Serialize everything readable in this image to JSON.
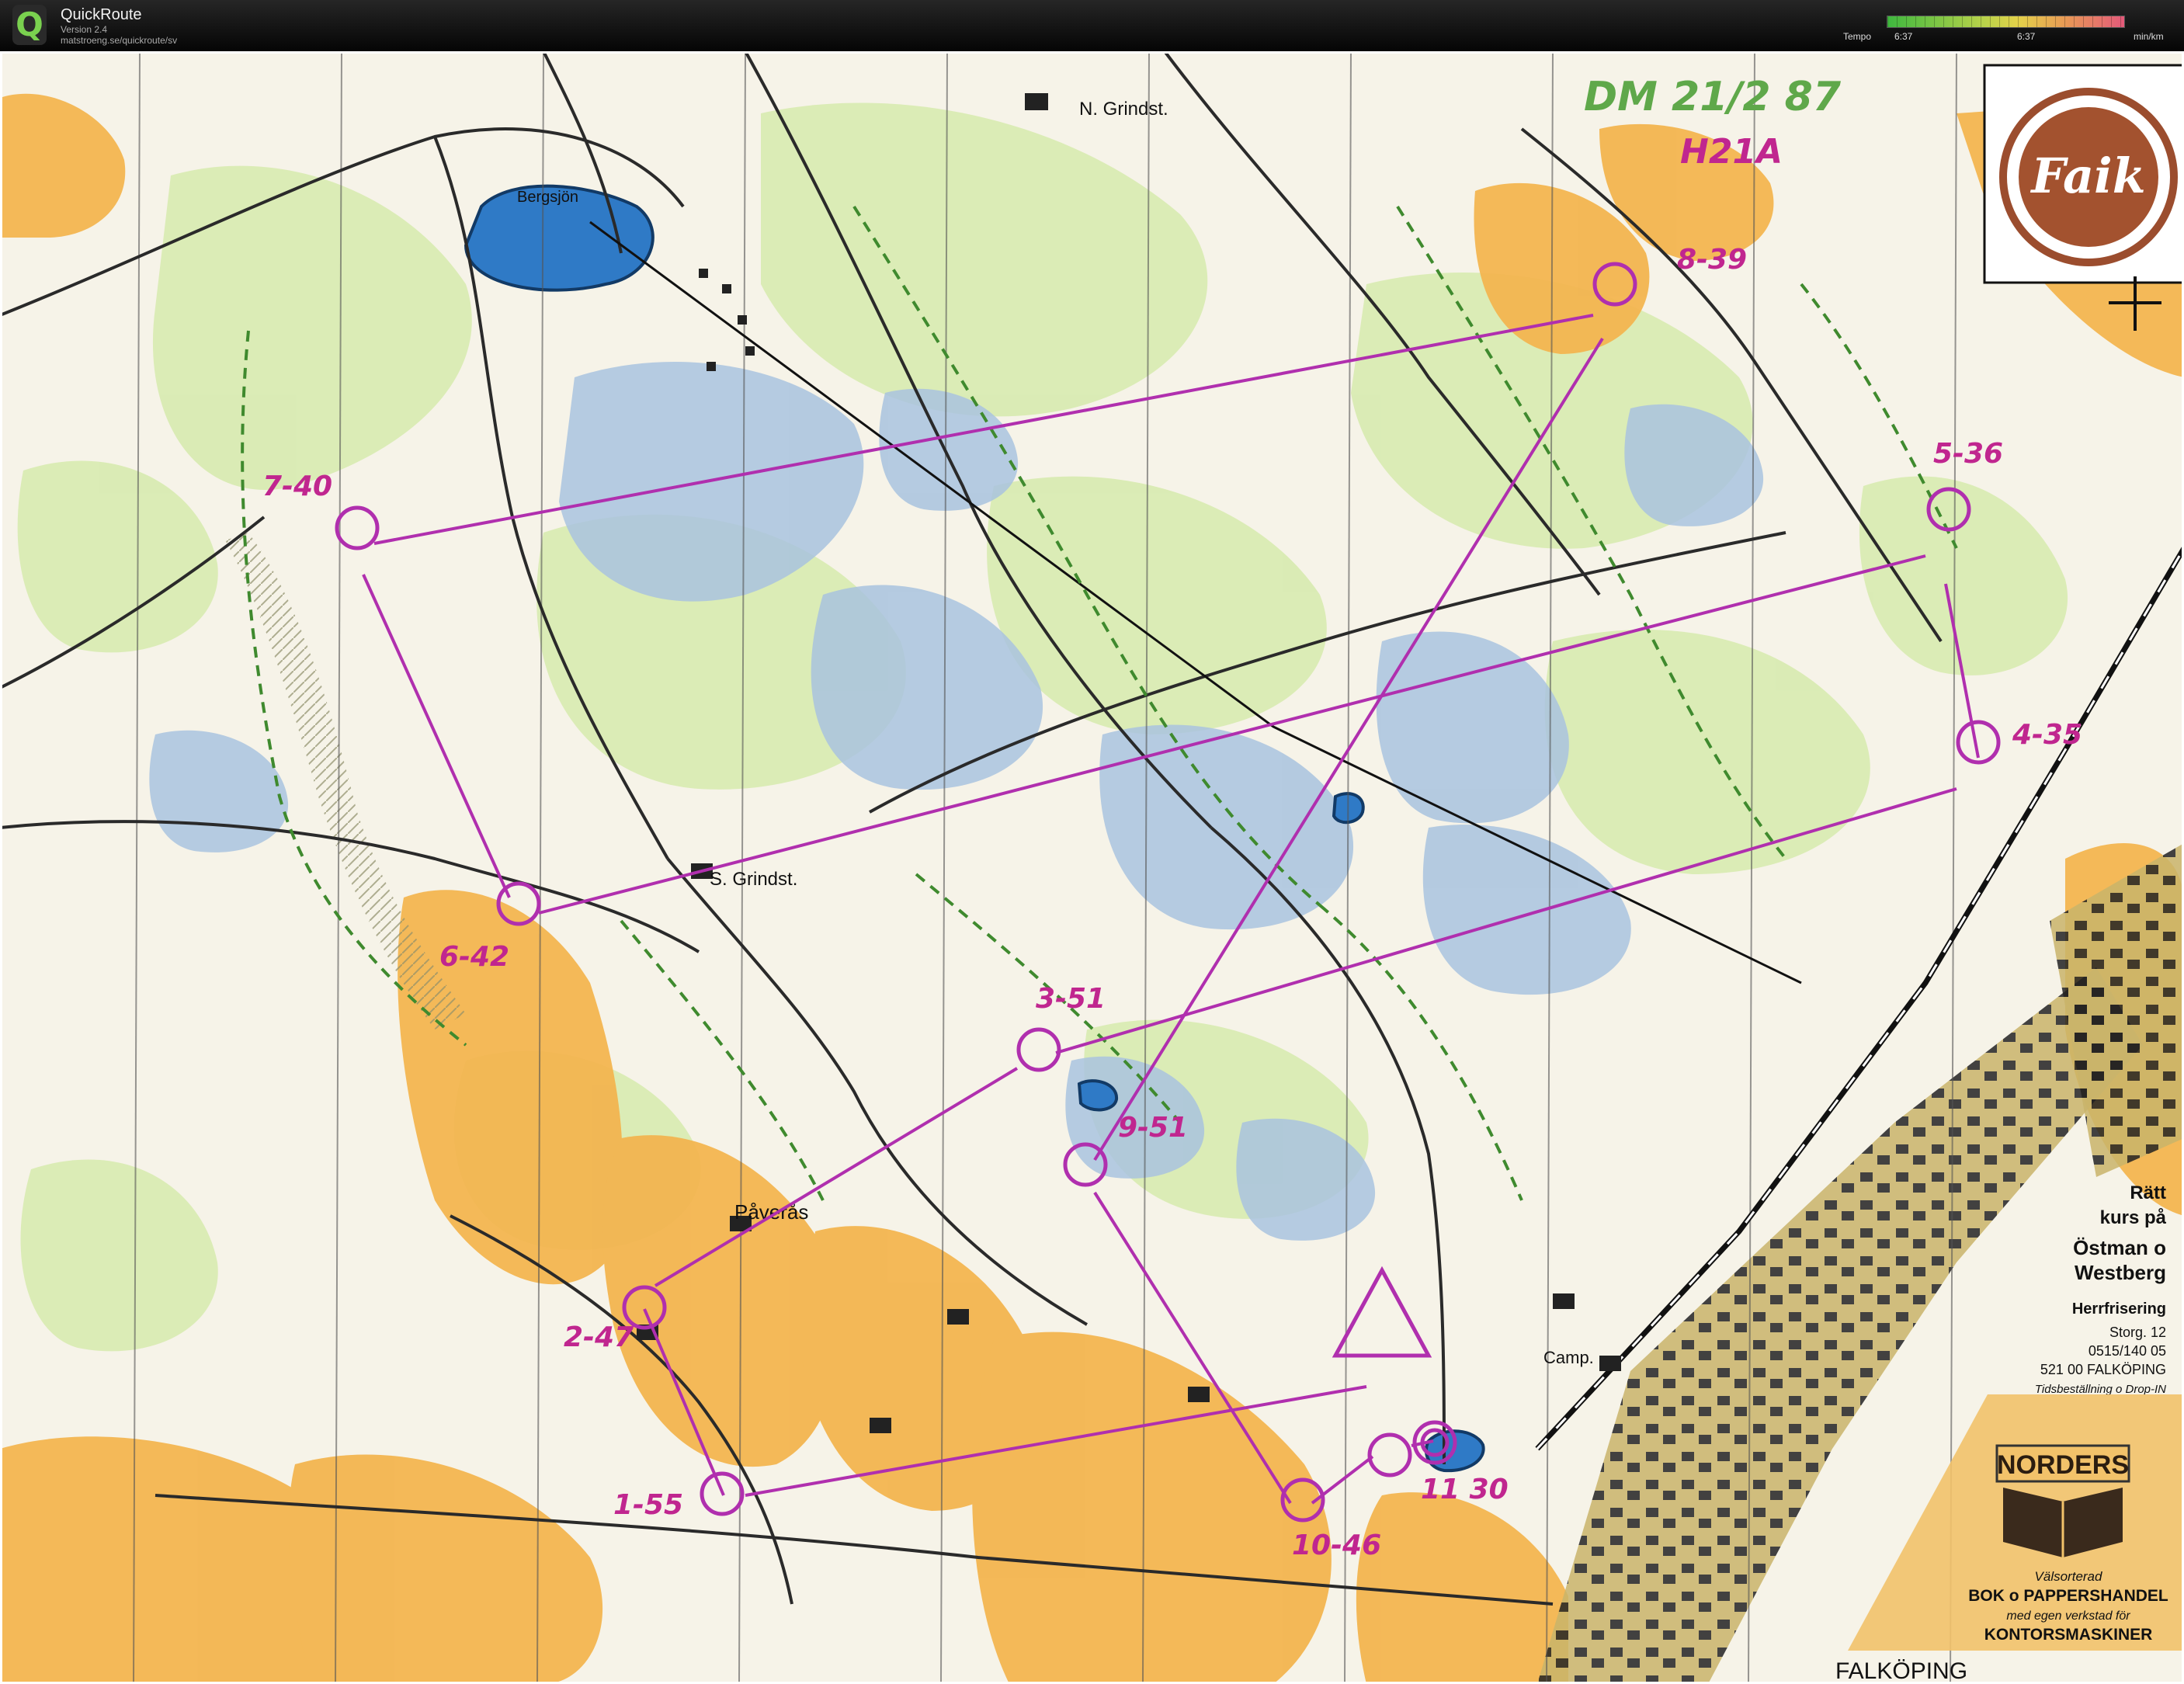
{
  "app": {
    "name": "QuickRoute",
    "version": "Version 2.4",
    "url": "matstroeng.se/quickroute/sv"
  },
  "tempo": {
    "label": "Tempo",
    "tick_left": "6:37",
    "tick_mid": "6:37",
    "unit": "min/km"
  },
  "map": {
    "header_handwritten": "DM 21/2 87",
    "class_handwritten": "H21A",
    "place_labels": {
      "bergsjon": "Bergsjön",
      "n_grindst": "N. Grindst.",
      "s_grindst": "S. Grindst.",
      "paveras": "Påverås",
      "camp": "Camp.",
      "falkoping": "FALKÖPING"
    },
    "controls": [
      {
        "label": "1-55"
      },
      {
        "label": "2-47"
      },
      {
        "label": "3-51"
      },
      {
        "label": "4-35"
      },
      {
        "label": "5-36"
      },
      {
        "label": "6-42"
      },
      {
        "label": "7-40"
      },
      {
        "label": "8-39"
      },
      {
        "label": "9-51"
      },
      {
        "label": "10-46"
      },
      {
        "label": "11 30"
      }
    ],
    "club_logo_text": "Faik",
    "ad_ostman": {
      "line1": "Rätt",
      "line2": "kurs på",
      "line3": "Östman o",
      "line4": "Westberg",
      "line5": "Herrfrisering",
      "line6": "Storg. 12",
      "line7": "0515/140 05",
      "line8": "521 00 FALKÖPING",
      "line9": "Tidsbeställning o Drop-IN"
    },
    "ad_norders": {
      "brand": "NORDERS",
      "line1": "Välsorterad",
      "line2": "BOK o PAPPERSHANDEL",
      "line3": "med egen verkstad för",
      "line4": "KONTORSMASKINER"
    },
    "colors": {
      "course": "#b02fae",
      "open_land": "#f2b24a",
      "marsh": "#9db8d8",
      "green": "#cfe6a0",
      "track": "#2a2a2a",
      "trail": "#3f8a2e"
    }
  }
}
